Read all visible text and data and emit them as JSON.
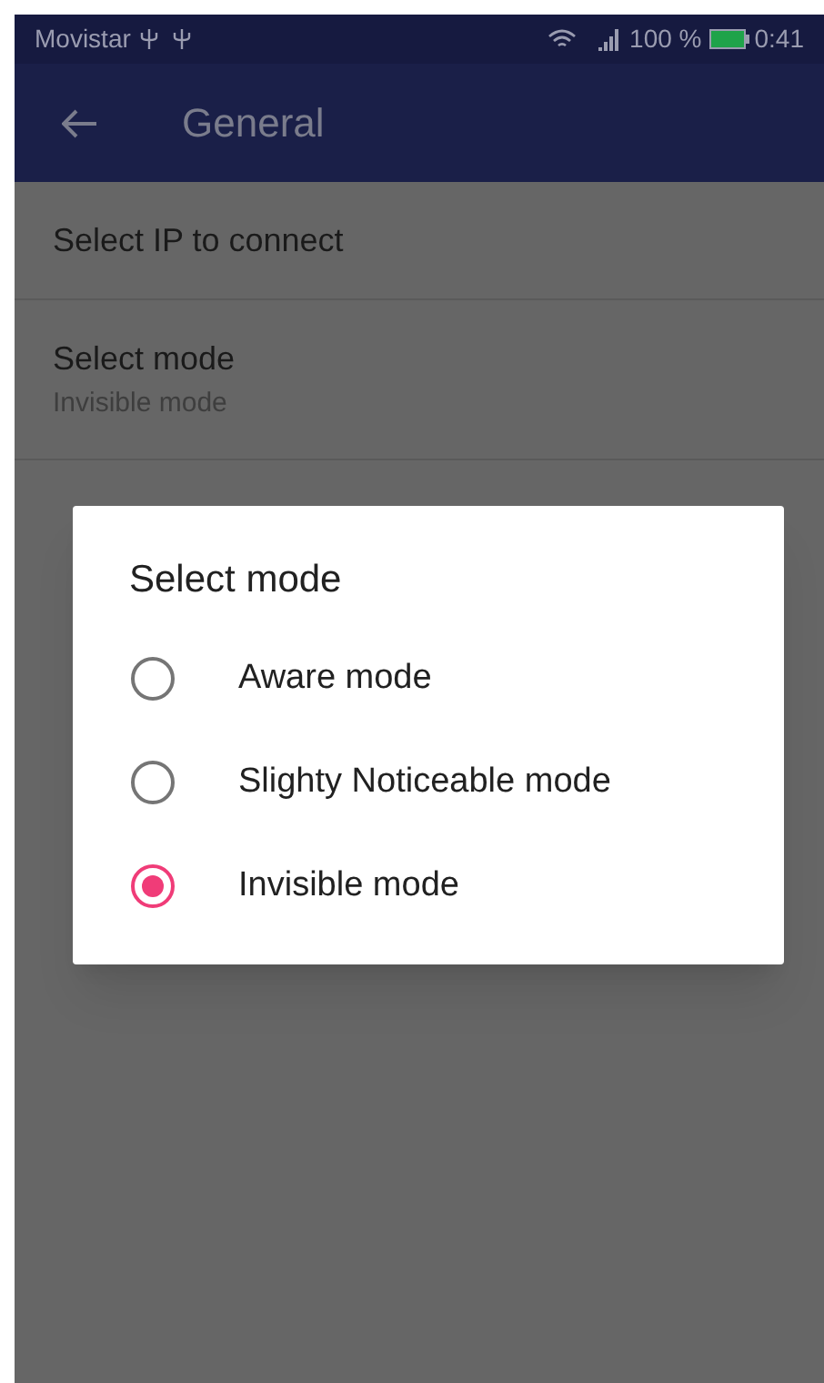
{
  "status_bar": {
    "carrier": "Movistar",
    "battery": "100 %",
    "time": "0:41"
  },
  "app_bar": {
    "title": "General"
  },
  "settings": [
    {
      "title": "Select IP to connect"
    },
    {
      "title": "Select mode",
      "summary": "Invisible mode"
    }
  ],
  "dialog": {
    "title": "Select mode",
    "options": [
      {
        "label": "Aware mode",
        "selected": false
      },
      {
        "label": "Slighty Noticeable mode",
        "selected": false
      },
      {
        "label": "Invisible mode",
        "selected": true
      }
    ]
  }
}
